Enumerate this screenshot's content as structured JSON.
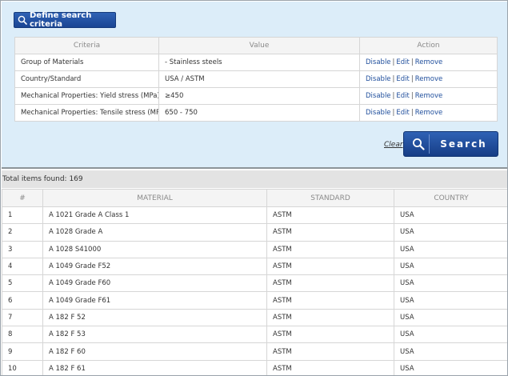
{
  "define_button": {
    "label": "Define search criteria",
    "icon": "search-icon"
  },
  "criteria_table": {
    "headers": [
      "Criteria",
      "Value",
      "Action"
    ],
    "rows": [
      {
        "criteria": "Group of Materials",
        "value": "- Stainless steels"
      },
      {
        "criteria": "Country/Standard",
        "value": "USA / ASTM"
      },
      {
        "criteria": "Mechanical Properties: Yield stress (MPa)",
        "value": "≥450"
      },
      {
        "criteria": "Mechanical Properties: Tensile stress (MPa)",
        "value": "650 - 750"
      }
    ],
    "actions": {
      "disable": "Disable",
      "edit": "Edit",
      "remove": "Remove",
      "separator": "|"
    }
  },
  "clear_label": "Clear",
  "search_button": {
    "label": "Search",
    "icon": "search-icon"
  },
  "total_text": "Total items found: 169",
  "results_table": {
    "headers": [
      "#",
      "MATERIAL",
      "STANDARD",
      "COUNTRY"
    ],
    "rows": [
      {
        "num": "1",
        "material": "A 1021 Grade A Class 1",
        "standard": "ASTM",
        "country": "USA"
      },
      {
        "num": "2",
        "material": "A 1028 Grade A",
        "standard": "ASTM",
        "country": "USA"
      },
      {
        "num": "3",
        "material": "A 1028 S41000",
        "standard": "ASTM",
        "country": "USA"
      },
      {
        "num": "4",
        "material": "A 1049 Grade F52",
        "standard": "ASTM",
        "country": "USA"
      },
      {
        "num": "5",
        "material": "A 1049 Grade F60",
        "standard": "ASTM",
        "country": "USA"
      },
      {
        "num": "6",
        "material": "A 1049 Grade F61",
        "standard": "ASTM",
        "country": "USA"
      },
      {
        "num": "7",
        "material": "A 182 F 52",
        "standard": "ASTM",
        "country": "USA"
      },
      {
        "num": "8",
        "material": "A 182 F 53",
        "standard": "ASTM",
        "country": "USA"
      },
      {
        "num": "9",
        "material": "A 182 F 60",
        "standard": "ASTM",
        "country": "USA"
      },
      {
        "num": "10",
        "material": "A 182 F 61",
        "standard": "ASTM",
        "country": "USA"
      }
    ]
  },
  "colors": {
    "panel_bg": "#dcedf9",
    "button_blue": "#2a5aab",
    "link_blue": "#1f4e9c"
  }
}
